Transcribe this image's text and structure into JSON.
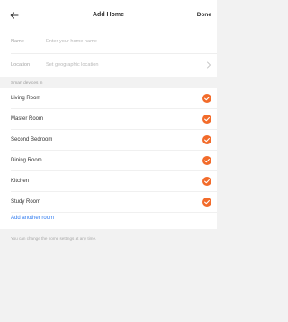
{
  "header": {
    "title": "Add Home",
    "done_label": "Done",
    "back_icon": "back-arrow-icon"
  },
  "form": {
    "name_label": "Name",
    "name_placeholder": "Enter your home name",
    "location_label": "Location",
    "location_value": "Set geographic location",
    "location_icon": "chevron-right-icon"
  },
  "section": {
    "label": "Smart devices in"
  },
  "rooms": [
    {
      "label": "Living Room",
      "checked": true
    },
    {
      "label": "Master Room",
      "checked": true
    },
    {
      "label": "Second Bedroom",
      "checked": true
    },
    {
      "label": "Dining Room",
      "checked": true
    },
    {
      "label": "Kitchen",
      "checked": true
    },
    {
      "label": "Study Room",
      "checked": true
    }
  ],
  "add_room_label": "Add another room",
  "hint": "You can change the home settings at any time.",
  "colors": {
    "accent": "#f26b2a",
    "link": "#2f7bf0",
    "background": "#f2f2f2"
  }
}
